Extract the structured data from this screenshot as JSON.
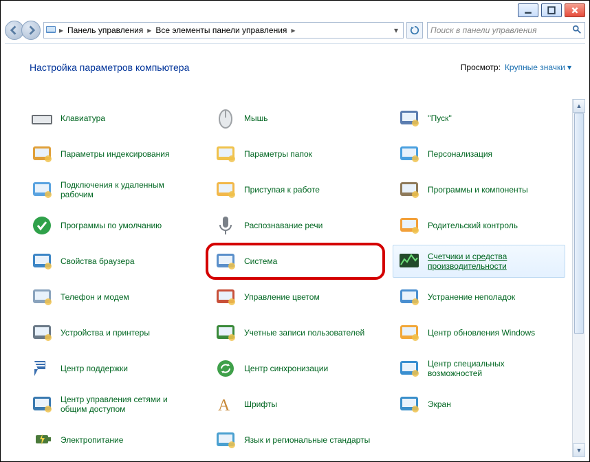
{
  "window": {
    "minimize_tip": "Свернуть",
    "maximize_tip": "Развернуть",
    "close_tip": "Закрыть"
  },
  "breadcrumb": {
    "sep": "▸",
    "items": [
      "Панель управления",
      "Все элементы панели управления"
    ]
  },
  "search": {
    "placeholder": "Поиск в панели управления"
  },
  "header": {
    "title": "Настройка параметров компьютера",
    "view_label": "Просмотр:",
    "view_value": "Крупные значки"
  },
  "items": [
    {
      "label": "Клавиатура",
      "icon": "keyboard"
    },
    {
      "label": "Мышь",
      "icon": "mouse"
    },
    {
      "label": "''Пуск''",
      "icon": "start-menu-props"
    },
    {
      "label": "Параметры индексирования",
      "icon": "indexing"
    },
    {
      "label": "Параметры папок",
      "icon": "folder-options"
    },
    {
      "label": "Персонализация",
      "icon": "personalization"
    },
    {
      "label": "Подключения к удаленным рабочим",
      "icon": "remote-app"
    },
    {
      "label": "Приступая к работе",
      "icon": "getting-started"
    },
    {
      "label": "Программы и компоненты",
      "icon": "programs"
    },
    {
      "label": "Программы по умолчанию",
      "icon": "default-programs"
    },
    {
      "label": "Распознавание речи",
      "icon": "speech"
    },
    {
      "label": "Родительский контроль",
      "icon": "parental"
    },
    {
      "label": "Свойства браузера",
      "icon": "internet-options"
    },
    {
      "label": "Система",
      "icon": "system",
      "highlight": true
    },
    {
      "label": "Счетчики и средства производительности",
      "icon": "performance",
      "hover": true
    },
    {
      "label": "Телефон и модем",
      "icon": "phone-modem"
    },
    {
      "label": "Управление цветом",
      "icon": "color-mgmt"
    },
    {
      "label": "Устранение неполадок",
      "icon": "troubleshoot"
    },
    {
      "label": "Устройства и принтеры",
      "icon": "devices-printers"
    },
    {
      "label": "Учетные записи пользователей",
      "icon": "user-accounts"
    },
    {
      "label": "Центр обновления Windows",
      "icon": "windows-update"
    },
    {
      "label": "Центр поддержки",
      "icon": "action-center"
    },
    {
      "label": "Центр синхронизации",
      "icon": "sync-center"
    },
    {
      "label": "Центр специальных возможностей",
      "icon": "ease-of-access"
    },
    {
      "label": "Центр управления сетями и общим доступом",
      "icon": "network-sharing"
    },
    {
      "label": "Шрифты",
      "icon": "fonts"
    },
    {
      "label": "Экран",
      "icon": "display"
    },
    {
      "label": "Электропитание",
      "icon": "power"
    },
    {
      "label": "Язык и региональные стандарты",
      "icon": "region-language"
    }
  ],
  "icon_colors": {
    "keyboard": "#6a6f74",
    "mouse": "#9ea2a6",
    "start-menu-props": "#5b7db0",
    "indexing": "#e0a03a",
    "folder-options": "#f0c24c",
    "personalization": "#4aa0df",
    "remote-app": "#5aa3e0",
    "getting-started": "#f2b84a",
    "programs": "#8e7a5a",
    "default-programs": "#2fa14a",
    "speech": "#7a8088",
    "parental": "#f2a03a",
    "internet-options": "#3d86c6",
    "system": "#5a8fca",
    "performance": "#2f8a3a",
    "phone-modem": "#8aa3bd",
    "color-mgmt": "#c8503a",
    "troubleshoot": "#4a8fd0",
    "devices-printers": "#6b7a88",
    "user-accounts": "#3a8a3a",
    "windows-update": "#f2a83a",
    "action-center": "#3a6fb0",
    "sync-center": "#3fa04a",
    "ease-of-access": "#3a8fd0",
    "network-sharing": "#3a7ab0",
    "fonts": "#c88a3a",
    "display": "#3a8fca",
    "power": "#e0a03a",
    "region-language": "#4aa0d0"
  }
}
